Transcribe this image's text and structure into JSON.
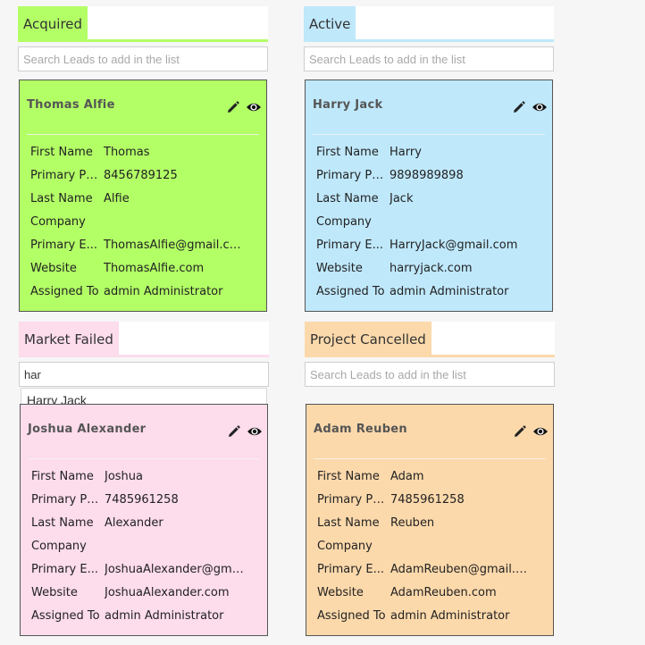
{
  "colors": {
    "acquired": "#b3ff66",
    "active": "#bfe8fb",
    "market_failed": "#fddcec",
    "project_cancelled": "#fcd9ab"
  },
  "field_labels": [
    "First Name",
    "Primary Ph...",
    "Last Name",
    "Company",
    "Primary E...",
    "Website",
    "Assigned To"
  ],
  "columns": [
    {
      "title": "Acquired",
      "search": {
        "value": "",
        "placeholder": "Search Leads to add in the list"
      },
      "card": {
        "name": "Thomas Alfie",
        "fields": [
          "Thomas",
          "8456789125",
          "Alfie",
          "",
          "ThomasAlfie@gmail.com",
          "ThomasAlfie.com",
          "admin Administrator"
        ]
      }
    },
    {
      "title": "Active",
      "search": {
        "value": "",
        "placeholder": "Search Leads to add in the list"
      },
      "card": {
        "name": "Harry Jack",
        "fields": [
          "Harry",
          "9898989898",
          "Jack",
          "",
          "HarryJack@gmail.com",
          "harryjack.com",
          "admin Administrator"
        ]
      }
    },
    {
      "title": "Market Failed",
      "search": {
        "value": "har",
        "placeholder": "Search Leads to add in the list"
      },
      "suggestion": "Harry Jack",
      "card": {
        "name": "Joshua Alexander",
        "fields": [
          "Joshua",
          "7485961258",
          "Alexander",
          "",
          "JoshuaAlexander@gmail.com",
          "JoshuaAlexander.com",
          "admin Administrator"
        ]
      }
    },
    {
      "title": "Project Cancelled",
      "search": {
        "value": "",
        "placeholder": "Search Leads to add in the list"
      },
      "card": {
        "name": "Adam Reuben",
        "fields": [
          "Adam",
          "7485961258",
          "Reuben",
          "",
          "AdamReuben@gmail.com",
          "AdamReuben.com",
          "admin Administrator"
        ]
      }
    }
  ],
  "icons": [
    "pencil-icon",
    "eye-icon"
  ]
}
